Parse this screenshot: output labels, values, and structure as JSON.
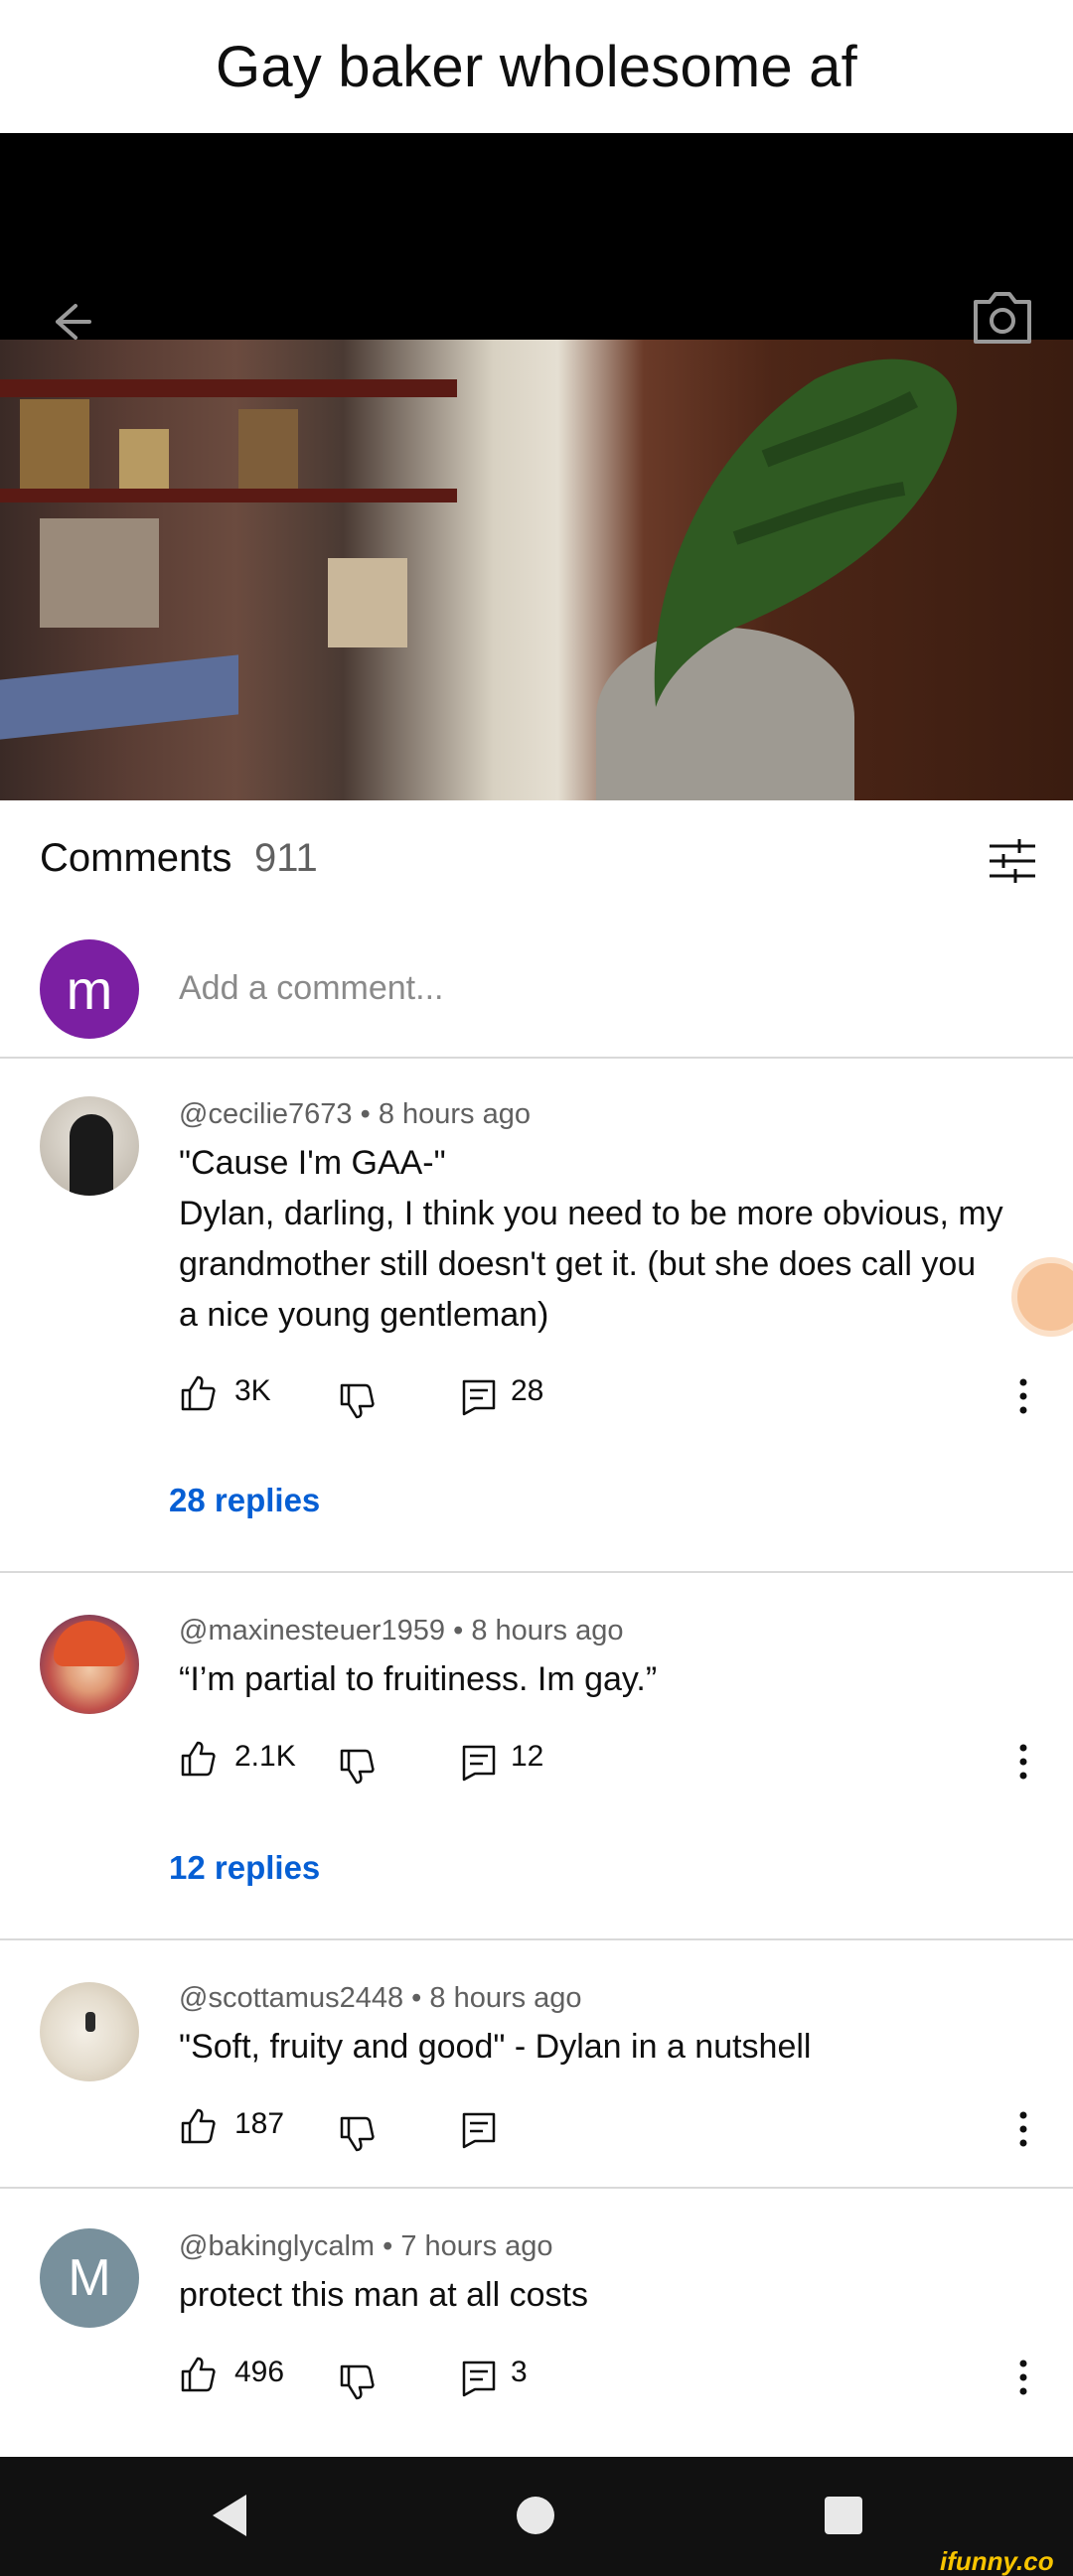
{
  "caption": "Gay baker wholesome af",
  "video": {
    "back_icon": "arrow-left-icon",
    "camera_icon": "camera-icon"
  },
  "comments_header": {
    "title": "Comments",
    "count": "911",
    "filter_icon": "sliders-icon"
  },
  "add_comment": {
    "avatar_letter": "m",
    "avatar_color": "#7b1fa2",
    "placeholder": "Add a comment..."
  },
  "comments": [
    {
      "author": "@cecilie7673",
      "time": "8 hours ago",
      "lines": [
        "\"Cause I'm GAA-\"",
        "Dylan, darling, I think you need to be more obvious, my",
        "grandmother still doesn't get it. (but she does call you",
        "a nice young gentleman)"
      ],
      "likes": "3K",
      "reply_count": "28",
      "replies_link": "28 replies"
    },
    {
      "author": "@maxinesteuer1959",
      "time": "8 hours ago",
      "lines": [
        "“I’m partial to fruitiness. Im gay.”"
      ],
      "likes": "2.1K",
      "reply_count": "12",
      "replies_link": "12 replies"
    },
    {
      "author": "@scottamus2448",
      "time": "8 hours ago",
      "lines": [
        "\"Soft, fruity and good\" - Dylan in a nutshell"
      ],
      "likes": "187",
      "reply_count": "",
      "replies_link": ""
    },
    {
      "author": "@bakinglycalm",
      "time": "7 hours ago",
      "lines": [
        "protect this man at all costs"
      ],
      "likes": "496",
      "reply_count": "3",
      "replies_link": "",
      "avatar_letter": "M",
      "avatar_color": "#78909c"
    }
  ],
  "navbar": {
    "back": "nav-back-icon",
    "home": "nav-home-icon",
    "recent": "nav-recents-icon"
  },
  "watermark": "ifunny.co",
  "colors": {
    "link_blue": "#065fd4",
    "meta_gray": "#606060",
    "divider": "#d9d9d9"
  }
}
